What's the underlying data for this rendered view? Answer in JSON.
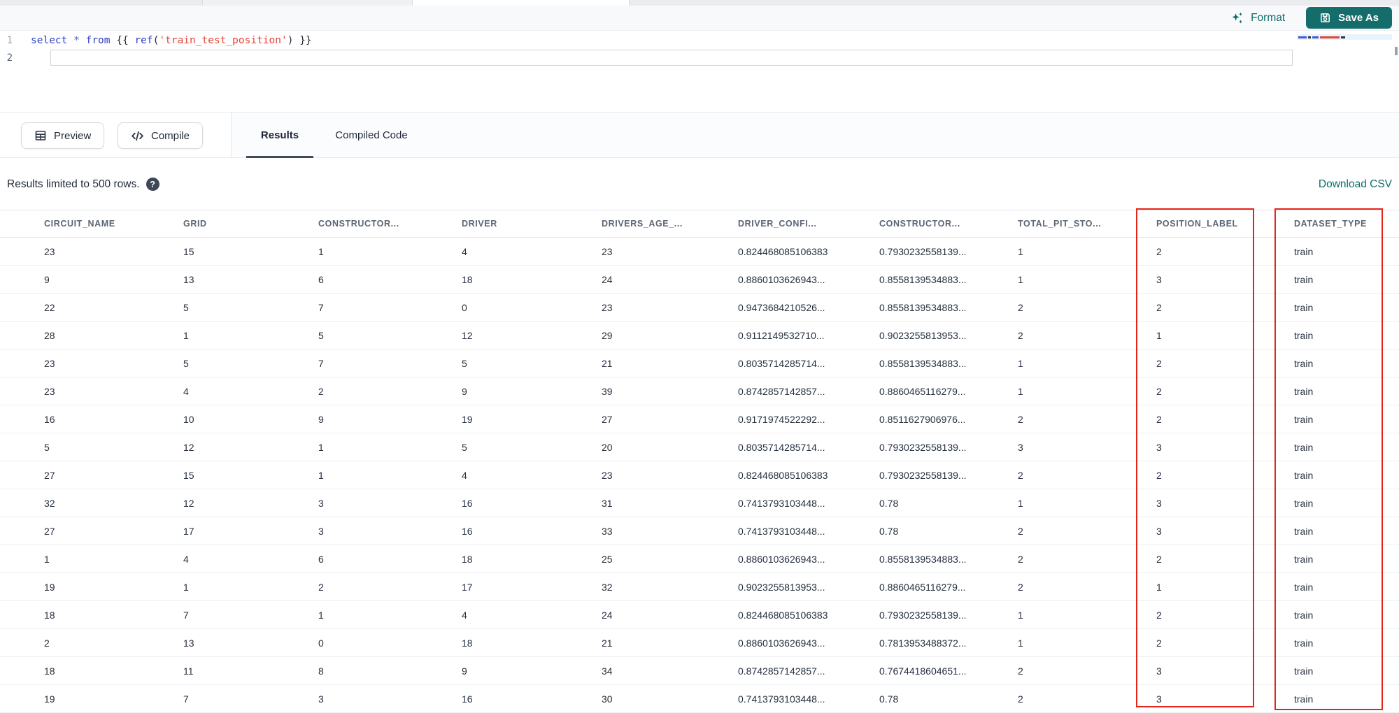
{
  "toolbar": {
    "format_label": "Format",
    "save_as_label": "Save As"
  },
  "editor": {
    "lines": [
      {
        "number": "1",
        "tokens": [
          {
            "text": "select",
            "type": "keyword"
          },
          {
            "text": " ",
            "type": "plain"
          },
          {
            "text": "*",
            "type": "operator"
          },
          {
            "text": " ",
            "type": "plain"
          },
          {
            "text": "from",
            "type": "keyword"
          },
          {
            "text": " ",
            "type": "plain"
          },
          {
            "text": "{{",
            "type": "brace"
          },
          {
            "text": " ",
            "type": "plain"
          },
          {
            "text": "ref",
            "type": "function"
          },
          {
            "text": "(",
            "type": "plain"
          },
          {
            "text": "'train_test_position'",
            "type": "string"
          },
          {
            "text": ")",
            "type": "plain"
          },
          {
            "text": " ",
            "type": "plain"
          },
          {
            "text": "}}",
            "type": "brace"
          }
        ]
      },
      {
        "number": "2",
        "tokens": []
      }
    ]
  },
  "action_bar": {
    "preview_label": "Preview",
    "compile_label": "Compile",
    "tabs": [
      {
        "label": "Results",
        "active": true
      },
      {
        "label": "Compiled Code",
        "active": false
      }
    ]
  },
  "results_bar": {
    "message": "Results limited to 500 rows.",
    "help_glyph": "?",
    "download_label": "Download CSV"
  },
  "table": {
    "columns": [
      "CIRCUIT_NAME",
      "GRID",
      "CONSTRUCTOR...",
      "DRIVER",
      "DRIVERS_AGE_...",
      "DRIVER_CONFI...",
      "CONSTRUCTOR...",
      "TOTAL_PIT_STO...",
      "POSITION_LABEL",
      "DATASET_TYPE"
    ],
    "highlighted_columns": [
      "POSITION_LABEL",
      "DATASET_TYPE"
    ],
    "rows": [
      [
        "23",
        "15",
        "1",
        "4",
        "23",
        "0.824468085106383",
        "0.7930232558139...",
        "1",
        "2",
        "train"
      ],
      [
        "9",
        "13",
        "6",
        "18",
        "24",
        "0.8860103626943...",
        "0.8558139534883...",
        "1",
        "3",
        "train"
      ],
      [
        "22",
        "5",
        "7",
        "0",
        "23",
        "0.9473684210526...",
        "0.8558139534883...",
        "2",
        "2",
        "train"
      ],
      [
        "28",
        "1",
        "5",
        "12",
        "29",
        "0.9112149532710...",
        "0.9023255813953...",
        "2",
        "1",
        "train"
      ],
      [
        "23",
        "5",
        "7",
        "5",
        "21",
        "0.8035714285714...",
        "0.8558139534883...",
        "1",
        "2",
        "train"
      ],
      [
        "23",
        "4",
        "2",
        "9",
        "39",
        "0.8742857142857...",
        "0.8860465116279...",
        "1",
        "2",
        "train"
      ],
      [
        "16",
        "10",
        "9",
        "19",
        "27",
        "0.9171974522292...",
        "0.8511627906976...",
        "2",
        "2",
        "train"
      ],
      [
        "5",
        "12",
        "1",
        "5",
        "20",
        "0.8035714285714...",
        "0.7930232558139...",
        "3",
        "3",
        "train"
      ],
      [
        "27",
        "15",
        "1",
        "4",
        "23",
        "0.824468085106383",
        "0.7930232558139...",
        "2",
        "2",
        "train"
      ],
      [
        "32",
        "12",
        "3",
        "16",
        "31",
        "0.7413793103448...",
        "0.78",
        "1",
        "3",
        "train"
      ],
      [
        "27",
        "17",
        "3",
        "16",
        "33",
        "0.7413793103448...",
        "0.78",
        "2",
        "3",
        "train"
      ],
      [
        "1",
        "4",
        "6",
        "18",
        "25",
        "0.8860103626943...",
        "0.8558139534883...",
        "2",
        "2",
        "train"
      ],
      [
        "19",
        "1",
        "2",
        "17",
        "32",
        "0.9023255813953...",
        "0.8860465116279...",
        "2",
        "1",
        "train"
      ],
      [
        "18",
        "7",
        "1",
        "4",
        "24",
        "0.824468085106383",
        "0.7930232558139...",
        "1",
        "2",
        "train"
      ],
      [
        "2",
        "13",
        "0",
        "18",
        "21",
        "0.8860103626943...",
        "0.7813953488372...",
        "1",
        "2",
        "train"
      ],
      [
        "18",
        "11",
        "8",
        "9",
        "34",
        "0.8742857142857...",
        "0.7674418604651...",
        "2",
        "3",
        "train"
      ],
      [
        "19",
        "7",
        "3",
        "16",
        "30",
        "0.7413793103448...",
        "0.78",
        "2",
        "3",
        "train"
      ]
    ]
  },
  "colors": {
    "accent_teal": "#0d6e69",
    "button_teal": "#156d6b",
    "highlight_red": "#e8231a"
  }
}
